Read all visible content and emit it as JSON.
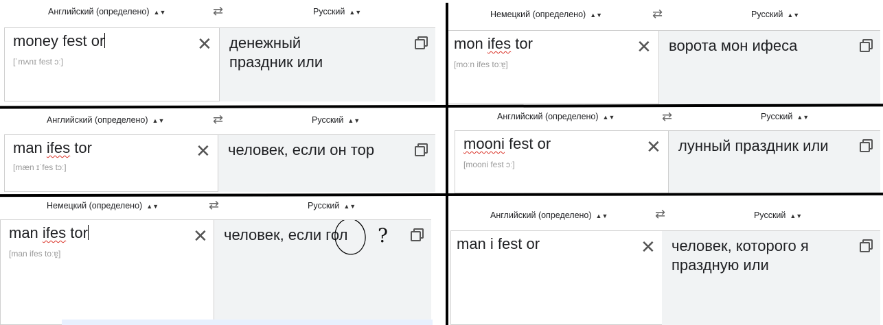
{
  "panels": [
    {
      "source_lang": "Английский (определено)",
      "target_lang": "Русский",
      "source_parts": [
        "money fest or"
      ],
      "translit": "[ˈmʌnɪ fest ɔː]",
      "translation": "денежный праздник или"
    },
    {
      "source_lang": "Немецкий (определено)",
      "target_lang": "Русский",
      "source_parts": [
        "mon ",
        "ifes",
        " tor"
      ],
      "translit": "[moːn ifes toːɐ̯]",
      "translation": "ворота мон ифеса"
    },
    {
      "source_lang": "Английский (определено)",
      "target_lang": "Русский",
      "source_parts": [
        "man ",
        "ifes",
        " tor"
      ],
      "translit": "[mæn ɪˈfes tɔː]",
      "translation": "человек, если он тор"
    },
    {
      "source_lang": "Английский (определено)",
      "target_lang": "Русский",
      "source_parts": [
        "",
        "mooni",
        " fest or"
      ],
      "translit": "[mooni fest ɔː]",
      "translation": "лунный праздник или"
    },
    {
      "source_lang": "Немецкий (определено)",
      "target_lang": "Русский",
      "source_parts": [
        "man ",
        "ifes",
        " tor"
      ],
      "translit": "[man ifes toːɐ̯]",
      "translation": "человек, если гол"
    },
    {
      "source_lang": "Английский (определено)",
      "target_lang": "Русский",
      "source_parts": [
        "man i fest or"
      ],
      "translit": "",
      "translation": "человек, которого я праздную или"
    }
  ],
  "annotation": {
    "question_mark": "?"
  },
  "icons": {
    "swap": "swap-arrows-icon",
    "clear": "close-icon",
    "copy": "copy-icon",
    "caret": "sort-caret-icon"
  }
}
